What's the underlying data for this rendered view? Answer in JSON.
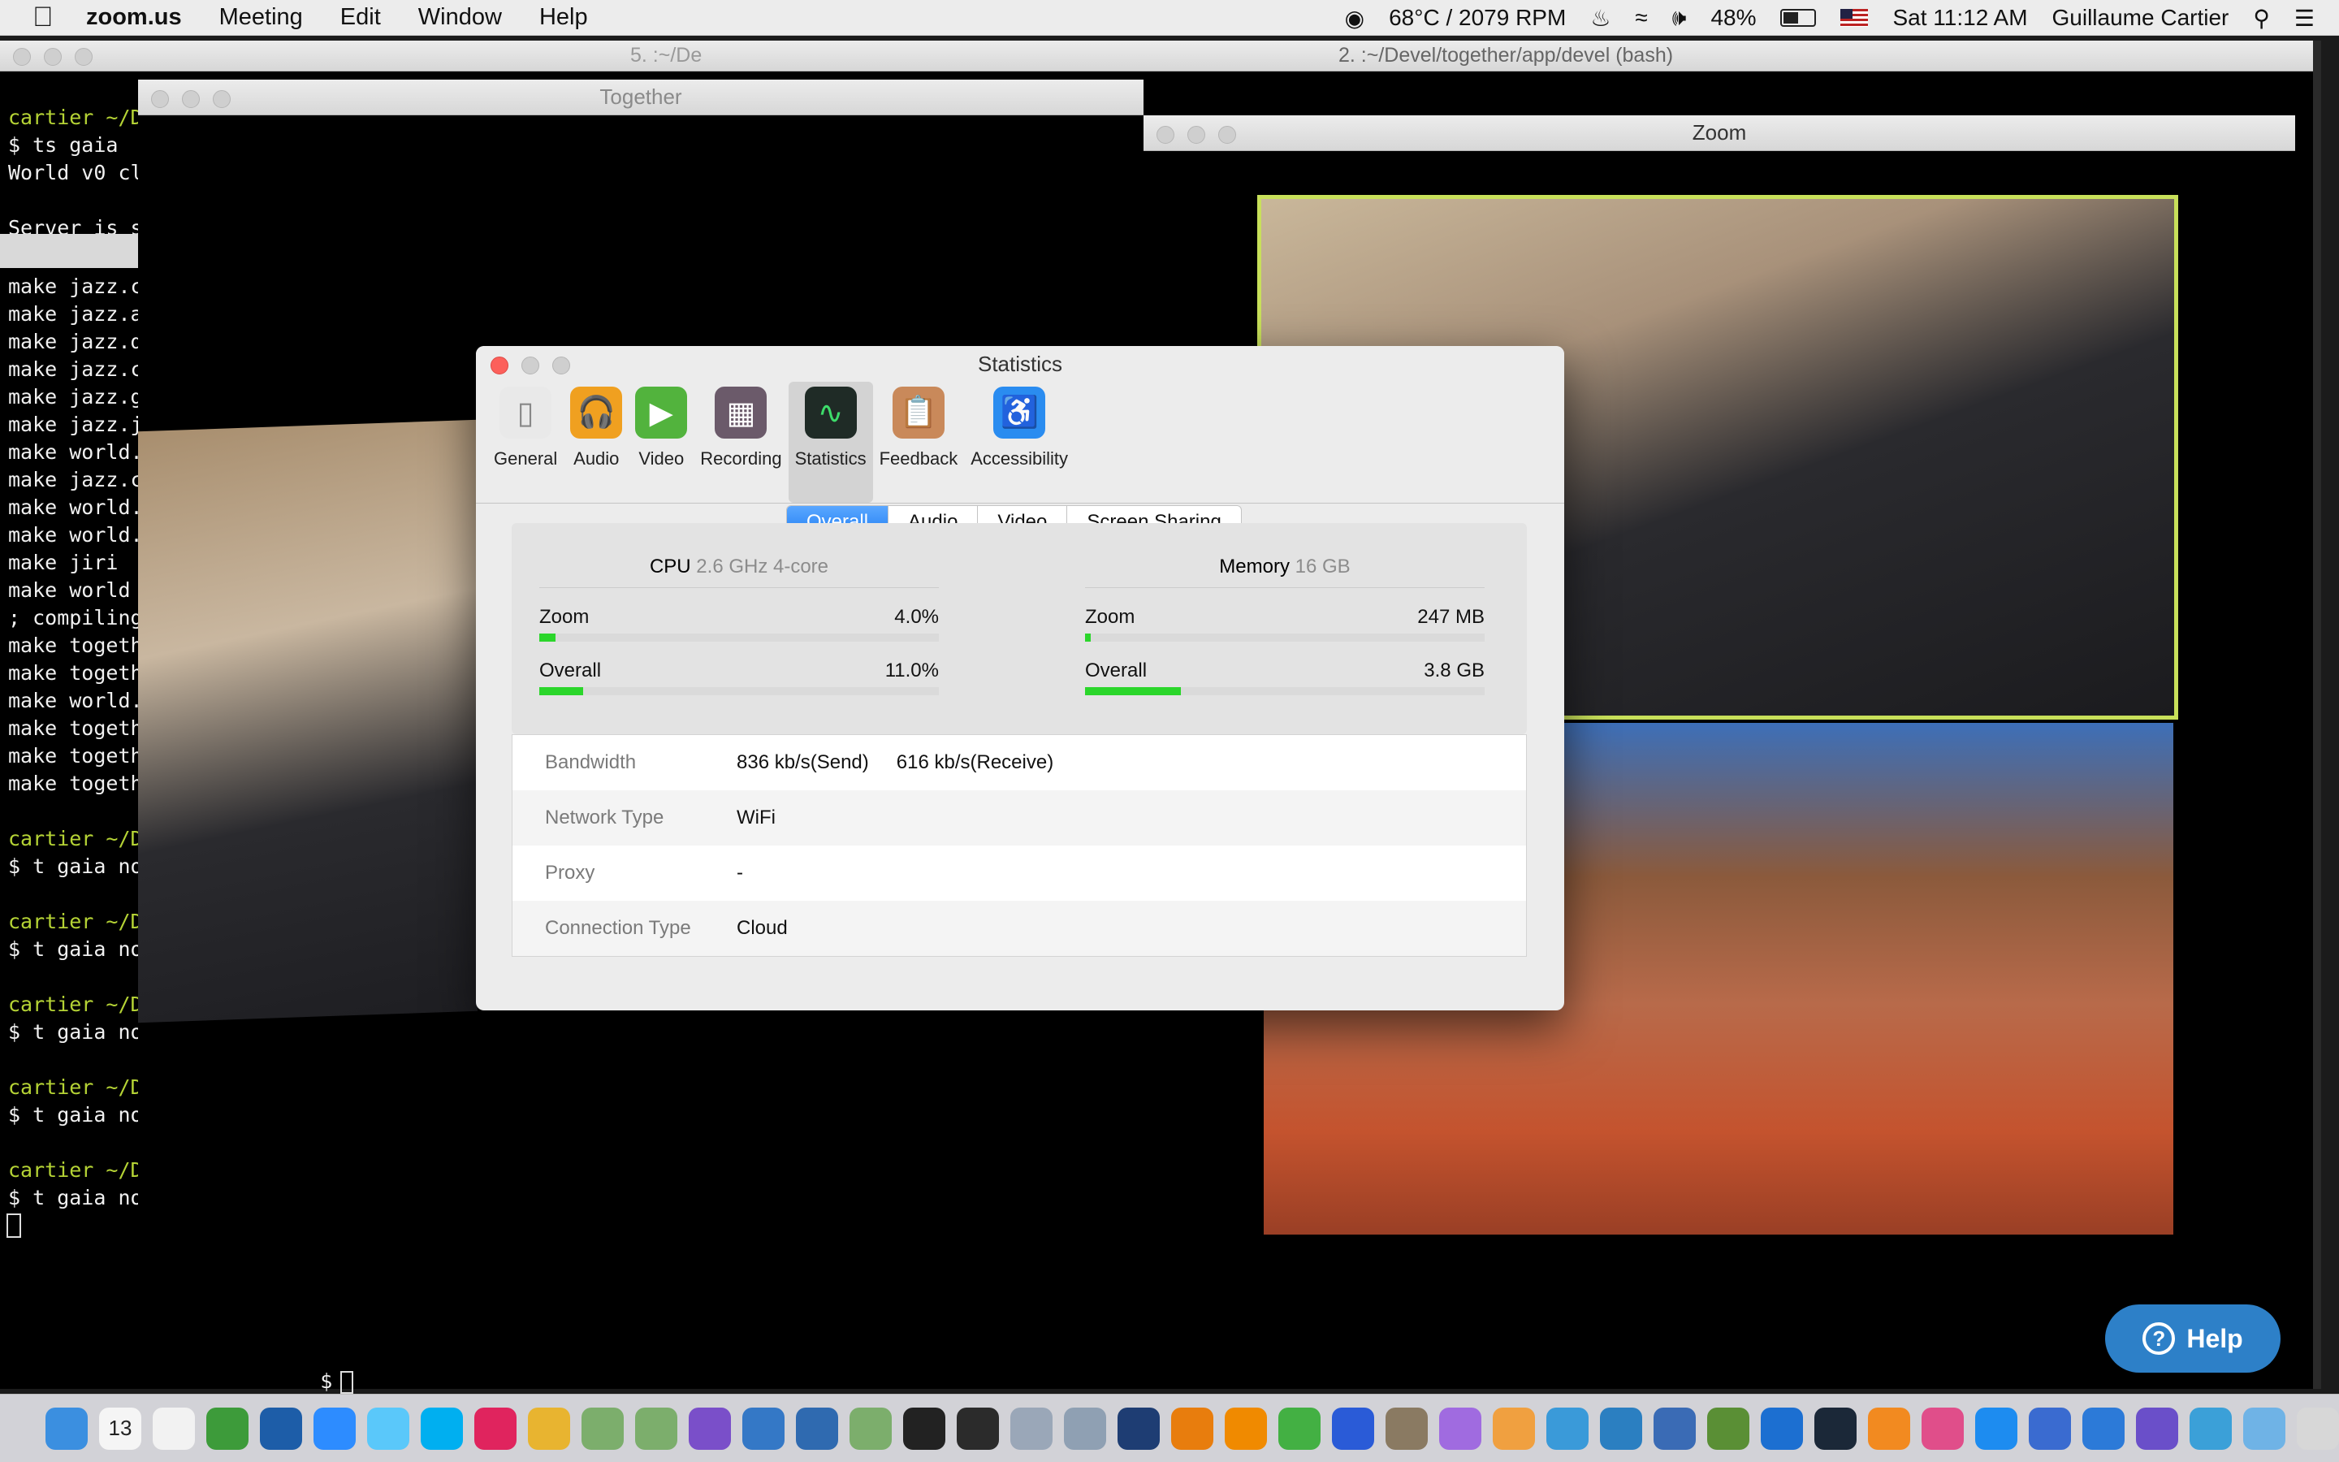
{
  "menubar": {
    "app_name": "zoom.us",
    "items": [
      "Meeting",
      "Edit",
      "Window",
      "Help"
    ],
    "temp_rpm": "68°C / 2079 RPM",
    "battery": "48%",
    "clock": "Sat 11:12 AM",
    "user": "Guillaume Cartier"
  },
  "windows": {
    "bash_title": "2. :~/Devel/together/app/devel (bash)",
    "bash_tab_partial": "5. :~/De",
    "together_title": "Together",
    "zoom_title": "Zoom"
  },
  "terminal": {
    "top_lines": [
      {
        "prompt": "cartier ~/D",
        "text": ""
      },
      {
        "prompt": "",
        "text": "$ ts gaia"
      },
      {
        "prompt": "",
        "text": "World v0 cl"
      },
      {
        "prompt": "",
        "text": ""
      },
      {
        "prompt": "",
        "text": "Server is s"
      }
    ],
    "make_lines": [
      "make jazz.c",
      "make jazz.a",
      "make jazz.d",
      "make jazz.c",
      "make jazz.g",
      "make jazz.j",
      "make world.",
      "make jazz.c",
      "make world.",
      "make world.",
      "make jiri",
      "make world",
      "; compiling",
      "make togeth",
      "make togeth",
      "make world.",
      "make togeth",
      "make togeth",
      "make togeth"
    ],
    "prompt_lines": [
      {
        "prompt": "cartier ~/D",
        "text": "$ t gaia no"
      },
      {
        "prompt": "cartier ~/D",
        "text": "$ t gaia no"
      },
      {
        "prompt": "cartier ~/D",
        "text": "$ t gaia no"
      },
      {
        "prompt": "cartier ~/D",
        "text": "$ t gaia no"
      },
      {
        "prompt": "cartier ~/D",
        "text": "$ t gaia no"
      }
    ],
    "bottom_prompt": "$"
  },
  "stats": {
    "title": "Statistics",
    "toolbar": [
      {
        "label": "General",
        "icon": "switch-icon",
        "color": "#e9e9e9"
      },
      {
        "label": "Audio",
        "icon": "headphones-icon",
        "color": "#f0a020"
      },
      {
        "label": "Video",
        "icon": "video-camera-icon",
        "color": "#52b33d"
      },
      {
        "label": "Recording",
        "icon": "film-icon",
        "color": "#6b5a6a"
      },
      {
        "label": "Statistics",
        "icon": "waveform-icon",
        "color": "#1f2b26"
      },
      {
        "label": "Feedback",
        "icon": "clipboard-icon",
        "color": "#c9895a"
      },
      {
        "label": "Accessibility",
        "icon": "accessibility-icon",
        "color": "#2a8cf0"
      }
    ],
    "tabs": [
      "Overall",
      "Audio",
      "Video",
      "Screen Sharing"
    ],
    "active_tab": "Overall",
    "cpu": {
      "title": "CPU",
      "sub": "2.6 GHz 4-core",
      "rows": [
        {
          "label": "Zoom",
          "value": "4.0%",
          "fraction": 0.04
        },
        {
          "label": "Overall",
          "value": "11.0%",
          "fraction": 0.11
        }
      ]
    },
    "memory": {
      "title": "Memory",
      "sub": "16 GB",
      "rows": [
        {
          "label": "Zoom",
          "value": "247 MB",
          "fraction": 0.015
        },
        {
          "label": "Overall",
          "value": "3.8 GB",
          "fraction": 0.24
        }
      ]
    },
    "info": [
      {
        "key": "Bandwidth",
        "value": "836 kb/s(Send)",
        "value2": "616 kb/s(Receive)"
      },
      {
        "key": "Network Type",
        "value": "WiFi",
        "value2": ""
      },
      {
        "key": "Proxy",
        "value": "-",
        "value2": ""
      },
      {
        "key": "Connection Type",
        "value": "Cloud",
        "value2": ""
      }
    ]
  },
  "help_button": "Help",
  "dock": {
    "icons": [
      {
        "name": "finder-icon",
        "color": "#3b8fe0"
      },
      {
        "name": "calendar-icon",
        "color": "#f5f5f5",
        "text": "13"
      },
      {
        "name": "textedit-icon",
        "color": "#f2f2f2"
      },
      {
        "name": "evernote-icon",
        "color": "#3d9b3a"
      },
      {
        "name": "1password-icon",
        "color": "#1d5da8"
      },
      {
        "name": "zoom-icon",
        "color": "#2d8cff"
      },
      {
        "name": "messages-icon",
        "color": "#5ac8fa"
      },
      {
        "name": "skype-icon",
        "color": "#00aff0"
      },
      {
        "name": "voice-memos-icon",
        "color": "#e0245e"
      },
      {
        "name": "chrome-icon",
        "color": "#e8b430"
      },
      {
        "name": "app-green-1-icon",
        "color": "#7cae6c"
      },
      {
        "name": "app-green-2-icon",
        "color": "#7cae6c"
      },
      {
        "name": "app-purple-icon",
        "color": "#7a4fc9"
      },
      {
        "name": "globe-1-icon",
        "color": "#3478c6"
      },
      {
        "name": "globe-2-icon",
        "color": "#2f6ab0"
      },
      {
        "name": "app-green-3-icon",
        "color": "#7cae6c"
      },
      {
        "name": "terminal-icon",
        "color": "#222222"
      },
      {
        "name": "activity-monitor-icon",
        "color": "#2b2b2b"
      },
      {
        "name": "preview-icon",
        "color": "#9aa7b8"
      },
      {
        "name": "image-capture-icon",
        "color": "#8fa0b3"
      },
      {
        "name": "quicktime-icon",
        "color": "#1e3d73"
      },
      {
        "name": "blender-icon",
        "color": "#e87d0d"
      },
      {
        "name": "vlc-icon",
        "color": "#f08a00"
      },
      {
        "name": "downloader-icon",
        "color": "#43b043"
      },
      {
        "name": "audio-app-icon",
        "color": "#2a5bd7"
      },
      {
        "name": "gimp-icon",
        "color": "#8a7a62"
      },
      {
        "name": "app-blue-icon",
        "color": "#a06be0"
      },
      {
        "name": "photos-icon",
        "color": "#f0a040"
      },
      {
        "name": "network-icon",
        "color": "#3a9ad9"
      },
      {
        "name": "globe-3-icon",
        "color": "#2b7fc1"
      },
      {
        "name": "google-earth-icon",
        "color": "#3a6bb5"
      },
      {
        "name": "minecraft-icon",
        "color": "#5a8f35"
      },
      {
        "name": "xcode-icon",
        "color": "#1c6fd1"
      },
      {
        "name": "steam-icon",
        "color": "#1b2838"
      },
      {
        "name": "ibooks-icon",
        "color": "#f28a20"
      },
      {
        "name": "itunes-icon",
        "color": "#e04e8a"
      },
      {
        "name": "app-store-icon",
        "color": "#1d8cf0"
      },
      {
        "name": "remote-desktop-icon",
        "color": "#3a6bd0"
      },
      {
        "name": "app-blue-2-icon",
        "color": "#2c7ad8"
      },
      {
        "name": "app-orb-icon",
        "color": "#6a4fc9"
      },
      {
        "name": "app-bird-icon",
        "color": "#3ba0d8"
      },
      {
        "name": "folder-icon",
        "color": "#6fb3e6"
      },
      {
        "name": "trash-icon",
        "color": "#d7d7d7"
      }
    ]
  }
}
